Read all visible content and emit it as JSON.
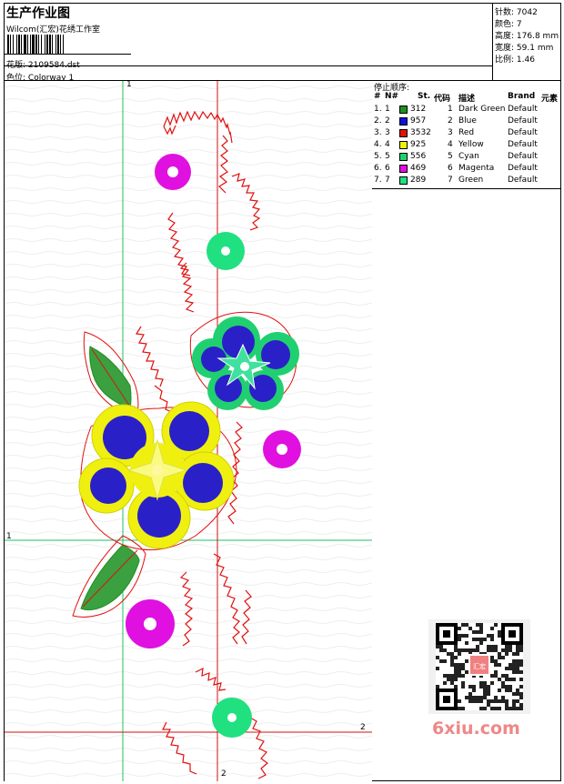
{
  "header": {
    "title": "生产作业图",
    "company": "Wilcom(汇宏)花绣工作室",
    "pattern_label": "花版:",
    "pattern_value": "2109584.dst",
    "colorway_label": "色位:",
    "colorway_value": "Colorway 1"
  },
  "stats": {
    "stitches_label": "针数:",
    "stitches_value": "7042",
    "colors_label": "颜色:",
    "colors_value": "7",
    "height_label": "高度:",
    "height_value": "176.8 mm",
    "width_label": "宽度:",
    "width_value": "59.1 mm",
    "scale_label": "比例:",
    "scale_value": "1.46"
  },
  "table": {
    "stop_label": "停止顺序:",
    "headers": [
      "#",
      "N#",
      "St.",
      "代码",
      "描述",
      "Brand",
      "元素"
    ],
    "rows": [
      {
        "idx": "1.",
        "n": "1",
        "st": "312",
        "code": "1",
        "desc": "Dark Green",
        "brand": "Default",
        "color": "#1f8f1f"
      },
      {
        "idx": "2.",
        "n": "2",
        "st": "957",
        "code": "2",
        "desc": "Blue",
        "brand": "Default",
        "color": "#1010d8"
      },
      {
        "idx": "3.",
        "n": "3",
        "st": "3532",
        "code": "3",
        "desc": "Red",
        "brand": "Default",
        "color": "#e01010"
      },
      {
        "idx": "4.",
        "n": "4",
        "st": "925",
        "code": "4",
        "desc": "Yellow",
        "brand": "Default",
        "color": "#f0f010"
      },
      {
        "idx": "5.",
        "n": "5",
        "st": "556",
        "code": "5",
        "desc": "Cyan",
        "brand": "Default",
        "color": "#20d070"
      },
      {
        "idx": "6.",
        "n": "6",
        "st": "469",
        "code": "6",
        "desc": "Magenta",
        "brand": "Default",
        "color": "#e010e0"
      },
      {
        "idx": "7.",
        "n": "7",
        "st": "289",
        "code": "7",
        "desc": "Green",
        "brand": "Default",
        "color": "#20e080"
      }
    ]
  },
  "axis": {
    "top_1": "1",
    "left_1": "1",
    "bottom_2": "2",
    "right_2": "2"
  },
  "watermark": "6xiu.com",
  "qr_label": "汇宏"
}
